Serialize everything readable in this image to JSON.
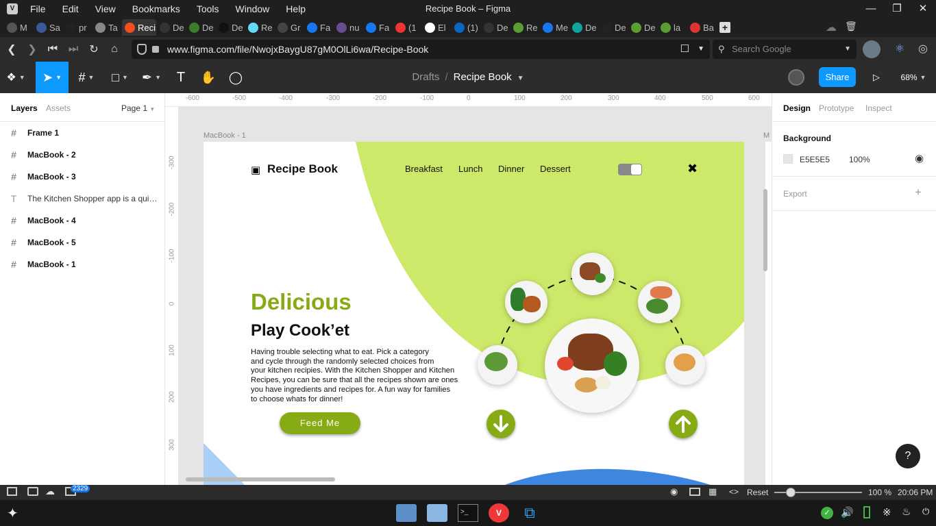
{
  "os": {
    "window_title": "Recipe Book – Figma",
    "menus": [
      "File",
      "Edit",
      "View",
      "Bookmarks",
      "Tools",
      "Window",
      "Help"
    ]
  },
  "browser": {
    "tabs": [
      {
        "label": "M",
        "color": "#555"
      },
      {
        "label": "Sa",
        "color": "#3b5998"
      },
      {
        "label": "pr",
        "color": "#222"
      },
      {
        "label": "Ta",
        "color": "#888"
      },
      {
        "label": "Reci",
        "color": "#f24e1e",
        "active": true
      },
      {
        "label": "De",
        "color": "#333"
      },
      {
        "label": "De",
        "color": "#3a7d2c"
      },
      {
        "label": "De",
        "color": "#111"
      },
      {
        "label": "Re",
        "color": "#61dafb"
      },
      {
        "label": "Gr",
        "color": "#444"
      },
      {
        "label": "Fa",
        "color": "#1877f2"
      },
      {
        "label": "nu",
        "color": "#6a4c93"
      },
      {
        "label": "Fa",
        "color": "#1877f2"
      },
      {
        "label": "(1",
        "color": "#e33"
      },
      {
        "label": "El",
        "color": "#fff"
      },
      {
        "label": "(1)",
        "color": "#0a66c2"
      },
      {
        "label": "De",
        "color": "#333"
      },
      {
        "label": "Re",
        "color": "#5a9e32"
      },
      {
        "label": "Me",
        "color": "#1877f2"
      },
      {
        "label": "De",
        "color": "#0ea5a0"
      },
      {
        "label": "De",
        "color": "#222"
      },
      {
        "label": "De",
        "color": "#5a9e32"
      },
      {
        "label": "la",
        "color": "#5a9e32"
      },
      {
        "label": "Ba",
        "color": "#d33"
      }
    ],
    "url": "www.figma.com/file/NwojxBaygU87gM0OlLi6wa/Recipe-Book",
    "search_placeholder": "Search Google"
  },
  "figma": {
    "breadcrumb_drafts": "Drafts",
    "breadcrumb_file": "Recipe Book",
    "share_label": "Share",
    "zoom": "68%",
    "left_tabs": {
      "layers": "Layers",
      "assets": "Assets",
      "page": "Page 1"
    },
    "layers": [
      {
        "name": "Frame 1",
        "type": "frame"
      },
      {
        "name": "MacBook - 2",
        "type": "frame"
      },
      {
        "name": "MacBook - 3",
        "type": "frame"
      },
      {
        "name": "The Kitchen Shopper app is a quic...",
        "type": "text"
      },
      {
        "name": "MacBook - 4",
        "type": "frame"
      },
      {
        "name": "MacBook - 5",
        "type": "frame"
      },
      {
        "name": "MacBook - 1",
        "type": "frame"
      }
    ],
    "right_tabs": {
      "design": "Design",
      "prototype": "Prototype",
      "inspect": "Inspect"
    },
    "background": {
      "label": "Background",
      "hex": "E5E5E5",
      "opacity": "100%"
    },
    "export_label": "Export",
    "frame_label": "MacBook - 1",
    "frame_label_2": "M",
    "ruler_h": [
      "-600",
      "-500",
      "-400",
      "-300",
      "-200",
      "-100",
      "0",
      "100",
      "200",
      "300",
      "400",
      "500",
      "600"
    ],
    "ruler_v": [
      "-300",
      "-200",
      "-100",
      "0",
      "100",
      "200",
      "300"
    ],
    "help": "?"
  },
  "design": {
    "brand": "Recipe Book",
    "nav": [
      "Breakfast",
      "Lunch",
      "Dinner",
      "Dessert"
    ],
    "headline": "Delicious",
    "subheadline": "Play Cook’et",
    "body": [
      "Having trouble selecting what to eat. Pick a category",
      "and cycle through the randomly selected choices from",
      "your kitchen recipies. With the Kitchen Shopper and Kitchen",
      "Recipes, you can be sure that all the recipes shown are ones",
      "you have ingredients and recipes for. A fun way for families",
      "to choose whats for dinner!"
    ],
    "cta": "Feed Me",
    "accent": "#cde96a",
    "accent_dark": "#86ab14"
  },
  "statusbar": {
    "reset": "Reset",
    "zoom": "100 %",
    "time": "20:06 PM",
    "badge": "2329"
  }
}
